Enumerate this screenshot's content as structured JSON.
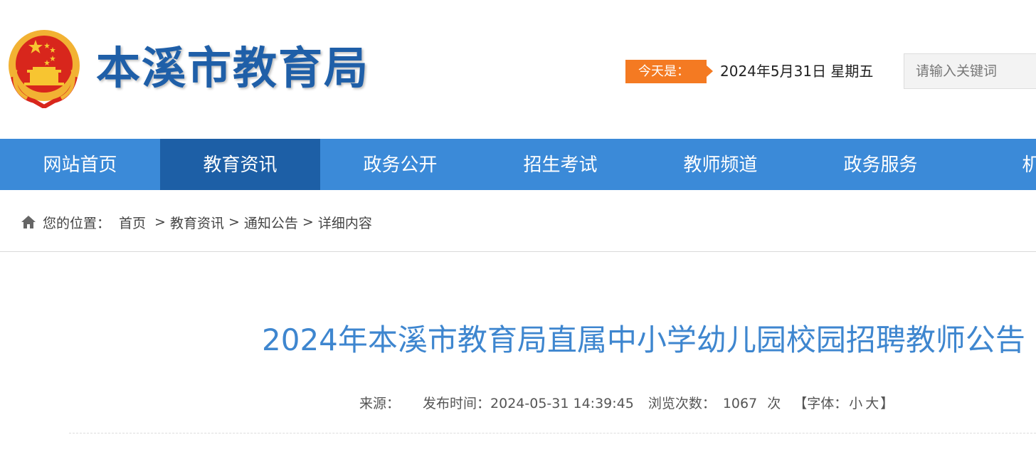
{
  "header": {
    "site_name": "本溪市教育局",
    "today_label": "今天是：",
    "today_date": "2024年5月31日 星期五",
    "search_placeholder": "请输入关键词"
  },
  "nav": {
    "items": [
      "网站首页",
      "教育资讯",
      "政务公开",
      "招生考试",
      "教师频道",
      "政务服务",
      "机构"
    ],
    "active_index": 1
  },
  "breadcrumb": {
    "label": "您的位置：",
    "items": [
      "首页",
      "教育资讯",
      "通知公告",
      "详细内容"
    ],
    "separator": ">"
  },
  "article": {
    "title": "2024年本溪市教育局直属中小学幼儿园校园招聘教师公告",
    "meta": {
      "source_label": "来源：",
      "publish_label": "发布时间：",
      "publish_time": "2024-05-31 14:39:45",
      "views_label": "浏览次数：",
      "views_count": "1067",
      "views_unit": "次",
      "font_label_open": "【字体：",
      "font_small": "小",
      "font_large": "大",
      "font_label_close": "】"
    }
  },
  "colors": {
    "nav_bg": "#3b8ad8",
    "nav_active": "#1d5fa6",
    "accent_orange": "#f47a22",
    "title_blue": "#3e86cf",
    "brand_blue": "#1f5fa8"
  },
  "icons": {
    "emblem": "national-emblem-icon",
    "home": "home-icon"
  }
}
